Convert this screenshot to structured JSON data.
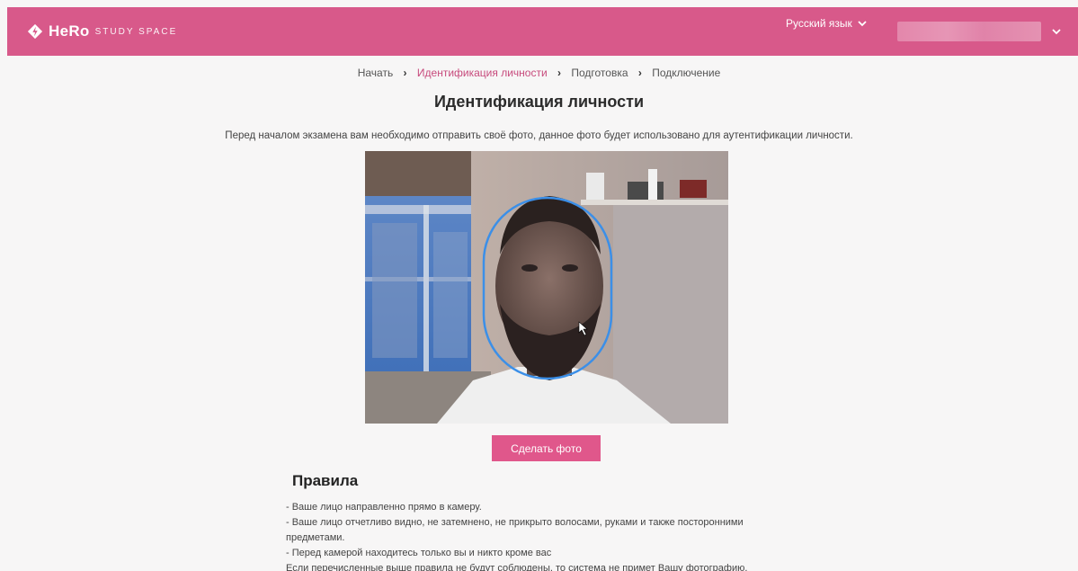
{
  "header": {
    "brand": "HeRo",
    "brand_sub": "STUDY SPACE",
    "language": "Русский язык",
    "bg_color": "#d8598a"
  },
  "breadcrumb": {
    "items": [
      "Начать",
      "Идентификация личности",
      "Подготовка",
      "Подключение"
    ],
    "active_index": 1
  },
  "page": {
    "title": "Идентификация личности",
    "intro": "Перед началом экзамена вам необходимо отправить своё фото, данное фото будет использовано для аутентификации личности."
  },
  "actions": {
    "take_photo": "Сделать фото",
    "accent_color": "#e0578b"
  },
  "rules": {
    "title": "Правила",
    "lines": [
      "- Ваше лицо направленно прямо в камеру.",
      "- Ваше лицо отчетливо видно, не затемнено, не прикрыто волосами, руками и также посторонними",
      "предметами.",
      "- Перед камерой находитесь только вы и никто кроме вас",
      "Если перечисленные выше правила не будут соблюдены, то система не примет Вашу фотографию."
    ]
  },
  "icons": {
    "logo": "hero-logo-icon",
    "language_dropdown": "chevron-down-icon",
    "user_dropdown": "chevron-down-icon",
    "breadcrumb_separator": "chevron-right-icon"
  }
}
